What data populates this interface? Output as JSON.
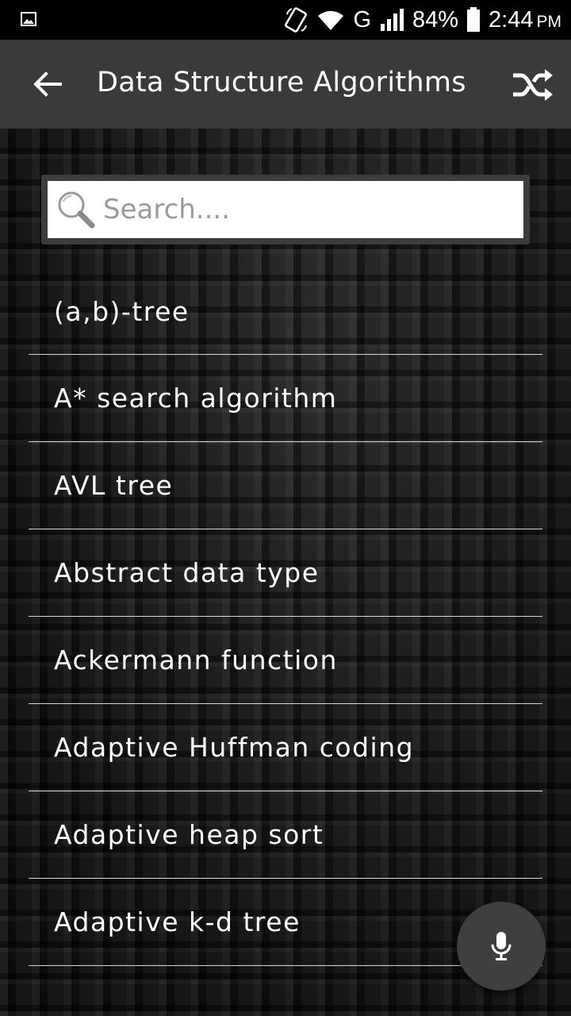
{
  "status_bar": {
    "battery": "84%",
    "time": "2:44",
    "ampm": "PM",
    "network": "G",
    "icons": [
      "image-icon",
      "rotate-icon",
      "wifi-icon",
      "signal-icon",
      "battery-icon"
    ]
  },
  "toolbar": {
    "title": "Data Structure Algorithms",
    "back_icon": "arrow-left-icon",
    "shuffle_icon": "shuffle-icon"
  },
  "search": {
    "placeholder": "Search....",
    "value": ""
  },
  "list": {
    "items": [
      {
        "label": "(a,b)-tree"
      },
      {
        "label": "A* search algorithm"
      },
      {
        "label": "AVL tree"
      },
      {
        "label": "Abstract data type"
      },
      {
        "label": "Ackermann function"
      },
      {
        "label": "Adaptive Huffman coding"
      },
      {
        "label": "Adaptive heap sort"
      },
      {
        "label": "Adaptive k-d tree"
      }
    ]
  },
  "fab": {
    "icon": "microphone-icon"
  },
  "colors": {
    "toolbar": "#3a3a3a",
    "status_bar": "#000000",
    "fab": "#3f3f3f",
    "divider": "#d8d8d8"
  }
}
